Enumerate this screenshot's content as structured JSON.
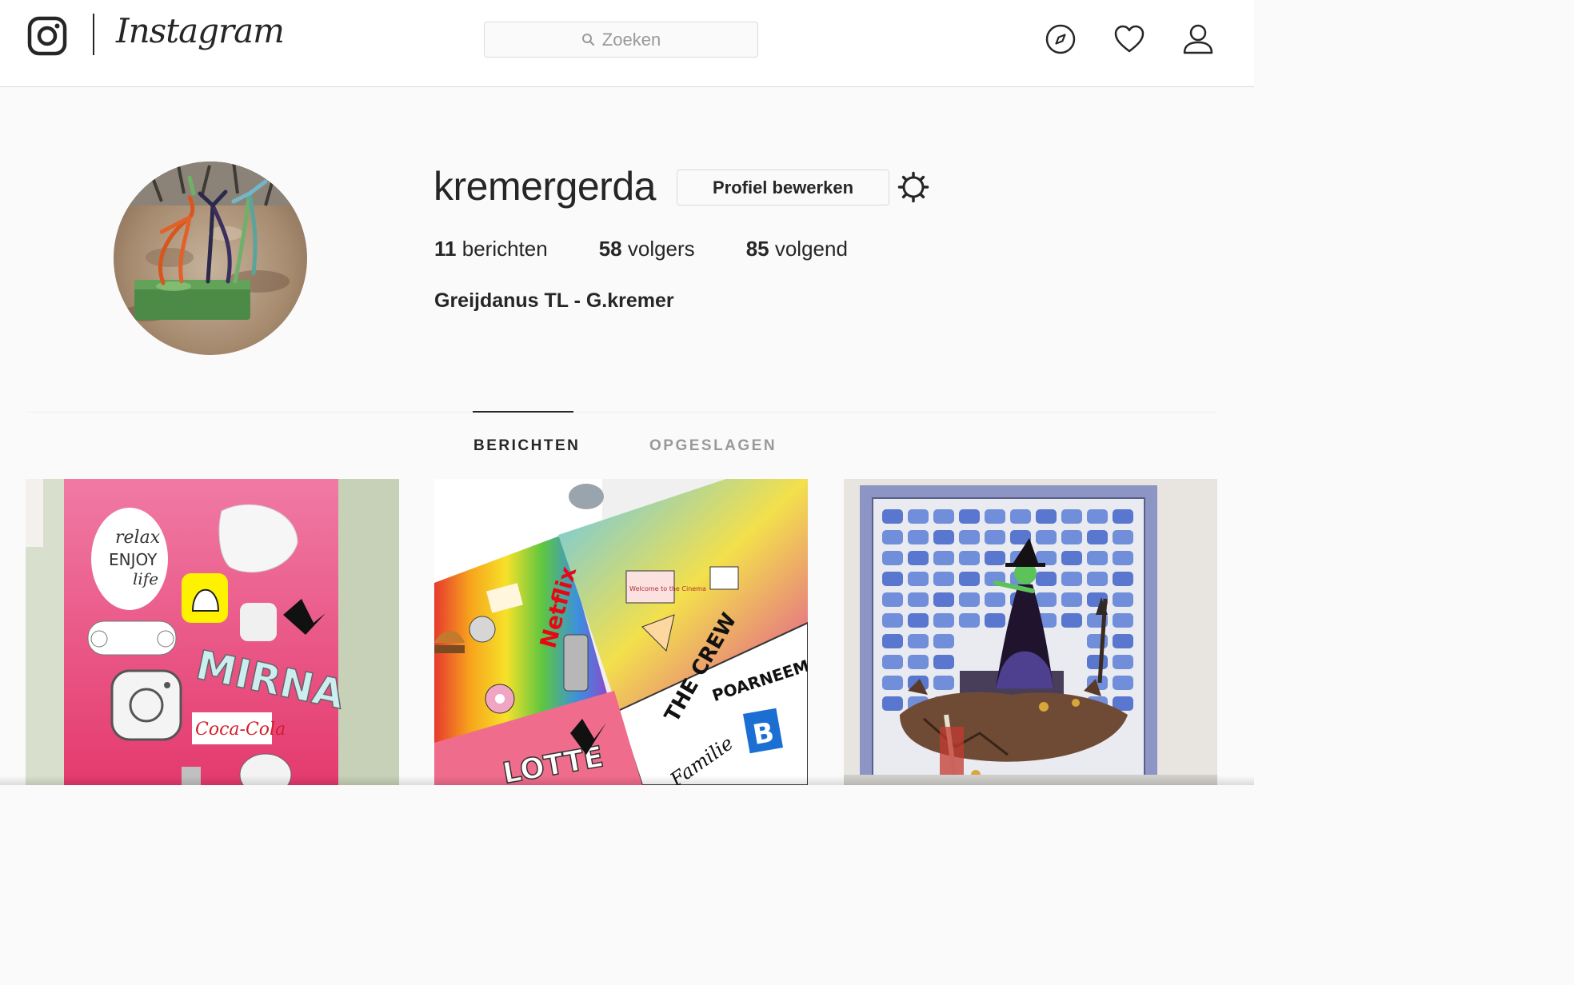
{
  "nav": {
    "wordmark": "Instagram",
    "search": {
      "placeholder": "Zoeken"
    }
  },
  "profile": {
    "username": "kremergerda",
    "edit_button": "Profiel bewerken",
    "stats": [
      {
        "count": "11",
        "label": "berichten"
      },
      {
        "count": "58",
        "label": "volgers"
      },
      {
        "count": "85",
        "label": "volgend"
      }
    ],
    "full_name": "Greijdanus TL - G.kremer"
  },
  "tabs": [
    {
      "label": "BERICHTEN",
      "active": true
    },
    {
      "label": "OPGESLAGEN",
      "active": false
    }
  ],
  "posts": [
    {
      "texts": {
        "relax": "relax",
        "enjoy": "ENJOY",
        "life": "life",
        "name": "MIRNA",
        "brand": "Coca-Cola"
      }
    },
    {
      "texts": {
        "brand": "Netflix",
        "crew": "THE CREW",
        "team": "POARNEEM'N",
        "family": "Familie",
        "cinema": "Welcome to the Cinema",
        "letter": "B",
        "name": "LOTTE"
      }
    },
    {
      "texts": {}
    }
  ],
  "colors": {
    "text": "#262626",
    "muted": "#999999",
    "border": "#dbdbdb",
    "background": "#fafafa"
  }
}
